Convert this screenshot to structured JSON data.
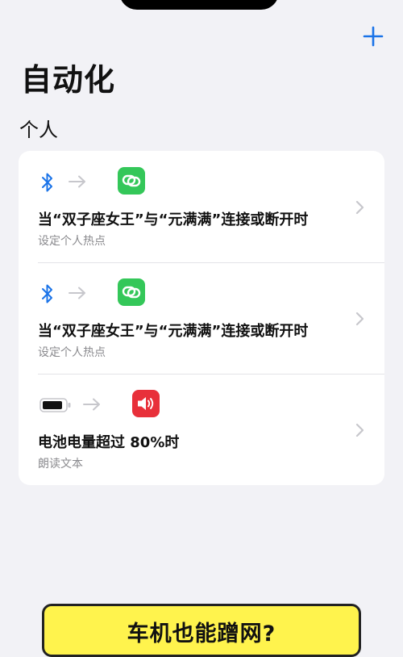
{
  "header": {
    "title": "自动化",
    "add_icon": "plus-icon",
    "accent_color": "#1a73e8"
  },
  "section": {
    "title": "个人"
  },
  "automations": [
    {
      "trigger_icon": "bluetooth-icon",
      "action_icon": "hotspot-link-icon",
      "title": "当“双子座女王”与“元满满”连接或断开时",
      "subtitle": "设定个人热点"
    },
    {
      "trigger_icon": "bluetooth-icon",
      "action_icon": "hotspot-link-icon",
      "title": "当“双子座女王”与“元满满”连接或断开时",
      "subtitle": "设定个人热点"
    },
    {
      "trigger_icon": "battery-icon",
      "action_icon": "speaker-icon",
      "title": "电池电量超过 80%时",
      "subtitle": "朗读文本"
    }
  ],
  "banner": {
    "text": "车机也能蹭网?"
  },
  "colors": {
    "background": "#f2f2f6",
    "card": "#ffffff",
    "hotspot_green": "#34c759",
    "speaker_red": "#e8303a",
    "banner_yellow": "#fff34d"
  }
}
